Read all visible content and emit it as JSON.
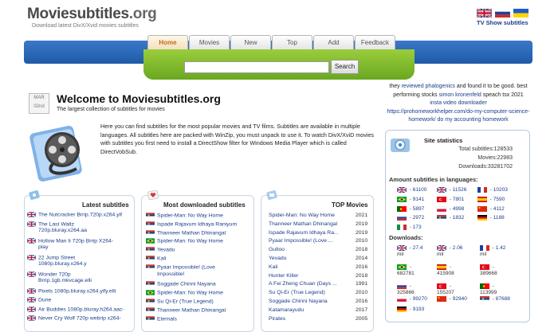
{
  "header": {
    "logo_bold": "Moviesubtitles",
    "logo_tld": ".org",
    "tagline": "Download latest DivX/Xvid movies subtitles",
    "tv_link": "TV Show subtitles",
    "flags": [
      "uk-flag-icon",
      "russia-flag-icon",
      "ukraine-flag-icon"
    ]
  },
  "nav": {
    "tabs": [
      "Home",
      "Movies",
      "New",
      "Top",
      "Add",
      "Feedback"
    ],
    "active_tab": "Home"
  },
  "search": {
    "placeholder": "",
    "button": "Search"
  },
  "welcome": {
    "month": "MAR",
    "day": "02nd",
    "title": "Welcome to Moviesubtitles.org",
    "subtitle": "The largest collection of subtitles for movies",
    "intro": "Here you can find subtitles for the most popular movies and TV films. Subtitles are available in multiple languages. All subtitles here are packed with WinZip, you must unpack to use it. To watch DivX/XviD movies with subtitles you first need to install a DirectShow filter for Windows Media Player which is called DirectVobSub."
  },
  "promo": {
    "line1a": "they ",
    "line1b": "reviewed phalogenics",
    "line1c": " and found it to be good. best performing stocks ",
    "line2a": "simon kronenfeld",
    "line2b": " speach tsx 2021 ",
    "line3": "insta video downloader",
    "line4": "https://prohomeworkhelper.com/do-my-computer-science-homework/",
    "line5": "do my accounting homework"
  },
  "stats": {
    "title": "Site statistics",
    "total_label": "Total subtitles:128533",
    "movies_label": "Movies:22983",
    "downloads_label": "Downloads:33281702",
    "languages_title": "Amount subtitles in languages:",
    "languages": [
      {
        "icon": "uk-flag-icon",
        "count": "- 61100"
      },
      {
        "icon": "uk-flag-icon",
        "count": "- 11526"
      },
      {
        "icon": "france-flag-icon",
        "count": "- 10203"
      },
      {
        "icon": "brazil-flag-icon",
        "count": "- 9141"
      },
      {
        "icon": "turkey-flag-icon",
        "count": "- 7801"
      },
      {
        "icon": "spain-flag-icon",
        "count": "- 7590"
      },
      {
        "icon": "portugal-flag-icon",
        "count": "- 5897"
      },
      {
        "icon": "poland-flag-icon",
        "count": "- 4998"
      },
      {
        "icon": "china-flag-icon",
        "count": "- 4112"
      },
      {
        "icon": "russia-flag-icon",
        "count": "- 2972"
      },
      {
        "icon": "serbia-flag-icon",
        "count": "- 1832"
      },
      {
        "icon": "germany-flag-icon",
        "count": "- 1188"
      },
      {
        "icon": "italy-flag-icon",
        "count": "- 173"
      }
    ],
    "downloads_title": "Downloads:",
    "downloads": [
      {
        "icon": "uk-flag-icon",
        "line1": "- 27.4",
        "line2": "mil"
      },
      {
        "icon": "uk-flag-icon",
        "line1": "- 2.06",
        "line2": "mil"
      },
      {
        "icon": "france-flag-icon",
        "line1": "- 1.42",
        "line2": "mil"
      },
      {
        "icon": "brazil-flag-icon",
        "line1": "-",
        "line2": "682781"
      },
      {
        "icon": "spain-flag-icon",
        "line1": "-",
        "line2": "415908"
      },
      {
        "icon": "turkey-flag-icon",
        "line1": "-",
        "line2": "389668"
      },
      {
        "icon": "russia-flag-icon",
        "line1": "-",
        "line2": "325866"
      },
      {
        "icon": "turkey-flag-icon",
        "line1": "-",
        "line2": "155207"
      },
      {
        "icon": "portugal-flag-icon",
        "line1": "-",
        "line2": "113999"
      },
      {
        "icon": "poland-flag-icon",
        "line1": "- 99270",
        "line2": ""
      },
      {
        "icon": "china-flag-icon",
        "line1": "- 92940",
        "line2": ""
      },
      {
        "icon": "serbia-flag-icon",
        "line1": "- 87688",
        "line2": ""
      },
      {
        "icon": "germany-flag-icon",
        "line1": "- 9193",
        "line2": ""
      }
    ]
  },
  "latest": {
    "title": "Latest subtitles",
    "items": [
      {
        "icon": "uk-flag-icon",
        "lines": [
          "The Nutcracker Brrip.720p.x264.yif"
        ]
      },
      {
        "icon": "uk-flag-icon",
        "lines": [
          "The Last Waltz",
          "720p.bluray.x264.aa"
        ]
      },
      {
        "icon": "uk-flag-icon",
        "lines": [
          "Hollow Man Ii 720p Brrip X264-",
          "play"
        ]
      },
      {
        "icon": "uk-flag-icon",
        "lines": [
          "22 Jump Street",
          "1080p.bluray.x264.y"
        ]
      },
      {
        "icon": "uk-flag-icon",
        "lines": [
          "Wonder 720p",
          "Brrip.1gb.mkvcage.elli"
        ]
      },
      {
        "icon": "uk-flag-icon",
        "lines": [
          "Pixels 1080p.bluray.x264.yify.elli"
        ]
      },
      {
        "icon": "uk-flag-icon",
        "lines": [
          "Dune"
        ]
      },
      {
        "icon": "uk-flag-icon",
        "lines": [
          "Air Buddies 1080p.bluray.h264.aac-"
        ]
      },
      {
        "icon": "uk-flag-icon",
        "lines": [
          "Never Cry Wolf 720p webrip x264-"
        ]
      }
    ]
  },
  "most_downloaded": {
    "title": "Most downloaded subtitles",
    "items": [
      {
        "icon": "serbia-flag-icon",
        "lines": [
          "Spider-Man: No Way Home"
        ]
      },
      {
        "icon": "serbia-flag-icon",
        "lines": [
          "Ispade Rajavum Idhaya Raniyum"
        ]
      },
      {
        "icon": "serbia-flag-icon",
        "lines": [
          "Thanneer Mathan Dhinangal"
        ]
      },
      {
        "icon": "brazil-flag-icon",
        "lines": [
          "Spider-Man: No Way Home"
        ]
      },
      {
        "icon": "serbia-flag-icon",
        "lines": [
          "Yevadu"
        ]
      },
      {
        "icon": "serbia-flag-icon",
        "lines": [
          "Kali"
        ]
      },
      {
        "icon": "serbia-flag-icon",
        "lines": [
          "Pyaar Impossible! (Love",
          "Impossible!"
        ]
      },
      {
        "icon": "serbia-flag-icon",
        "lines": [
          "Soggade Chinni Nayana"
        ]
      },
      {
        "icon": "brazil-flag-icon",
        "lines": [
          "Spider-Man: No Way Home"
        ]
      },
      {
        "icon": "serbia-flag-icon",
        "lines": [
          "Su Qi-Er (True Legend)"
        ]
      },
      {
        "icon": "serbia-flag-icon",
        "lines": [
          "Thanneer Mathan Dhinangal"
        ]
      },
      {
        "icon": "serbia-flag-icon",
        "lines": [
          "Eternals"
        ]
      }
    ]
  },
  "top_movies": {
    "title": "TOP Movies",
    "items": [
      {
        "title": "Spider-Man: No Way Home",
        "year": "2021"
      },
      {
        "title": "Thanneer Mathan Dhinangal",
        "year": "2019"
      },
      {
        "title": "Ispade Rajavum Idhaya Ra...",
        "year": "2019"
      },
      {
        "title": "Pyaar Impossible! (Love ...",
        "year": "2010"
      },
      {
        "title": "Gultoo",
        "year": "2018"
      },
      {
        "title": "Yevadu",
        "year": "2014"
      },
      {
        "title": "Kali",
        "year": "2016"
      },
      {
        "title": "Hunter Killer",
        "year": "2018"
      },
      {
        "title": "A Fei Zheng Chuan (Days ...",
        "year": "1991"
      },
      {
        "title": "Su Qi-Er (True Legend)",
        "year": "2010"
      },
      {
        "title": "Soggade Chinni Nayana",
        "year": "2016"
      },
      {
        "title": "Katamarayudu",
        "year": "2017"
      },
      {
        "title": "Pirates",
        "year": "2005"
      }
    ]
  }
}
